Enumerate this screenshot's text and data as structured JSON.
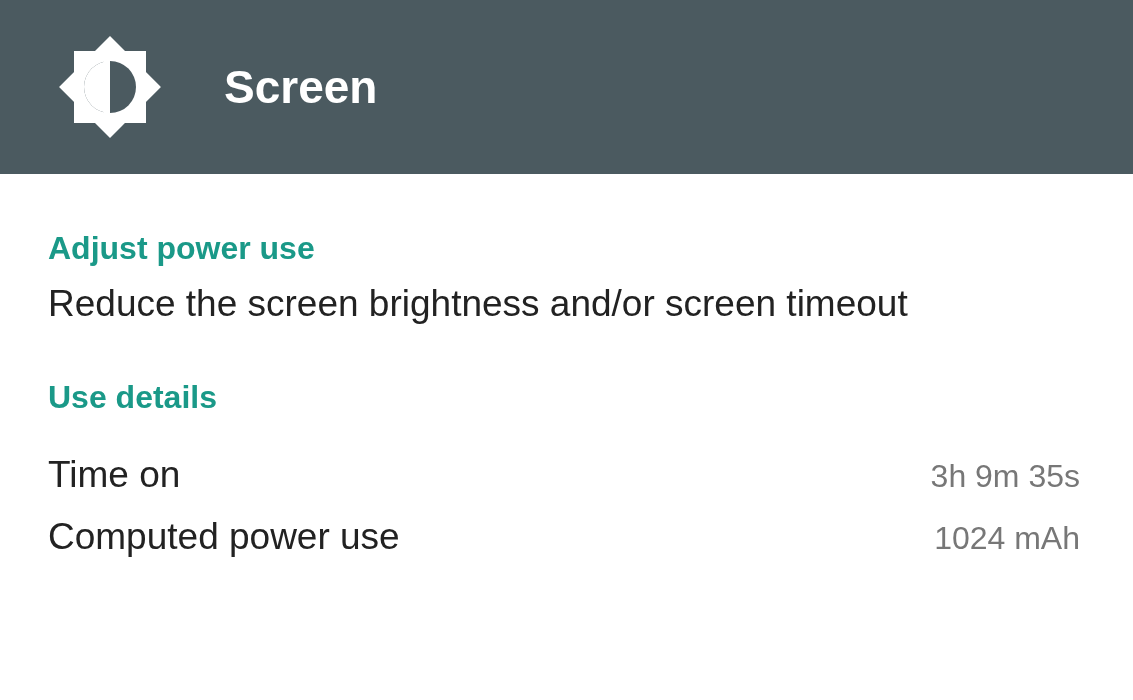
{
  "header": {
    "title": "Screen"
  },
  "sections": [
    {
      "heading": "Adjust power use",
      "text": "Reduce the screen brightness and/or screen timeout"
    },
    {
      "heading": "Use details",
      "rows": [
        {
          "label": "Time on",
          "value": "3h 9m 35s"
        },
        {
          "label": "Computed power use",
          "value": "1024 mAh"
        }
      ]
    }
  ]
}
